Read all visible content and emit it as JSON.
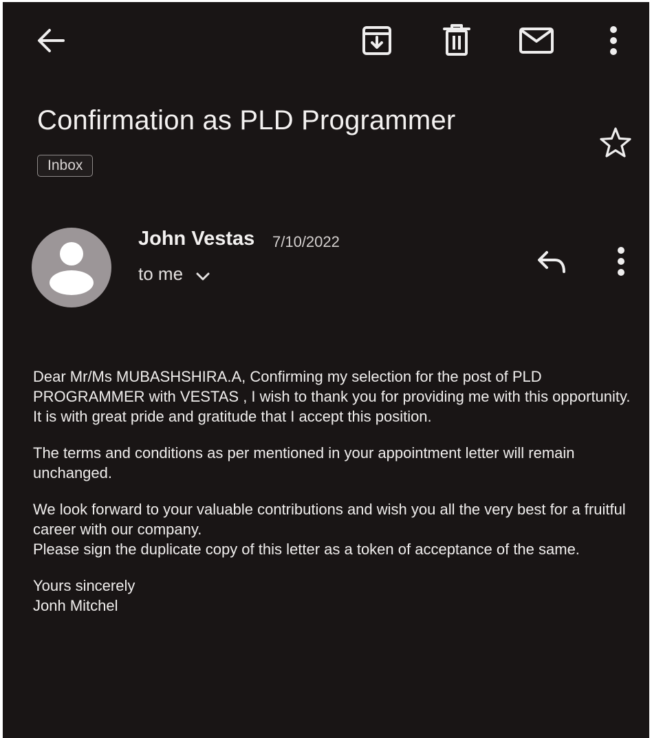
{
  "toolbar": {
    "icons": [
      "back-arrow-icon",
      "archive-icon",
      "delete-icon",
      "mark-unread-icon",
      "more-vert-icon"
    ]
  },
  "email": {
    "subject": "Confirmation as PLD Programmer",
    "label": "Inbox",
    "starred": false,
    "sender": {
      "name": "John Vestas",
      "date": "7/10/2022",
      "recipient": "to me"
    },
    "body": {
      "paragraph1": "Dear Mr/Ms MUBASHSHIRA.A, Confirming my selection for the post of PLD PROGRAMMER with VESTAS , I wish to thank you for providing me with this opportunity. It is with great pride and gratitude that I accept this position.",
      "paragraph2": "The terms and conditions as per mentioned in your appointment letter will remain unchanged.",
      "paragraph3_line1": "We look forward to your valuable contributions and wish you all the very best for a fruitful career with our company.",
      "paragraph3_line2": "Please sign the duplicate copy of this letter as a token of acceptance of the same.",
      "closing": "Yours sincerely",
      "signature": "Jonh Mitchel"
    }
  },
  "colors": {
    "background": "#191515",
    "text": "#f1efee",
    "avatar": "#9c9698"
  }
}
